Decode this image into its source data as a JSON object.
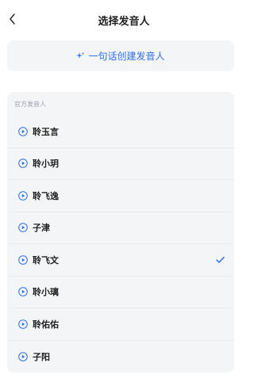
{
  "header": {
    "title": "选择发音人",
    "back_icon": "chevron-left-icon"
  },
  "create": {
    "label": "一句话创建发音人",
    "icon": "sparkle-icon",
    "color": "#2f6fe6"
  },
  "voices": {
    "section_label": "官方发音人",
    "selected_index": 4,
    "items": [
      {
        "name": "聆玉言"
      },
      {
        "name": "聆小玥"
      },
      {
        "name": "聆飞逸"
      },
      {
        "name": "子津"
      },
      {
        "name": "聆飞文"
      },
      {
        "name": "聆小璃"
      },
      {
        "name": "聆佑佑"
      },
      {
        "name": "子阳"
      }
    ]
  },
  "accent_color": "#2f6fe6"
}
